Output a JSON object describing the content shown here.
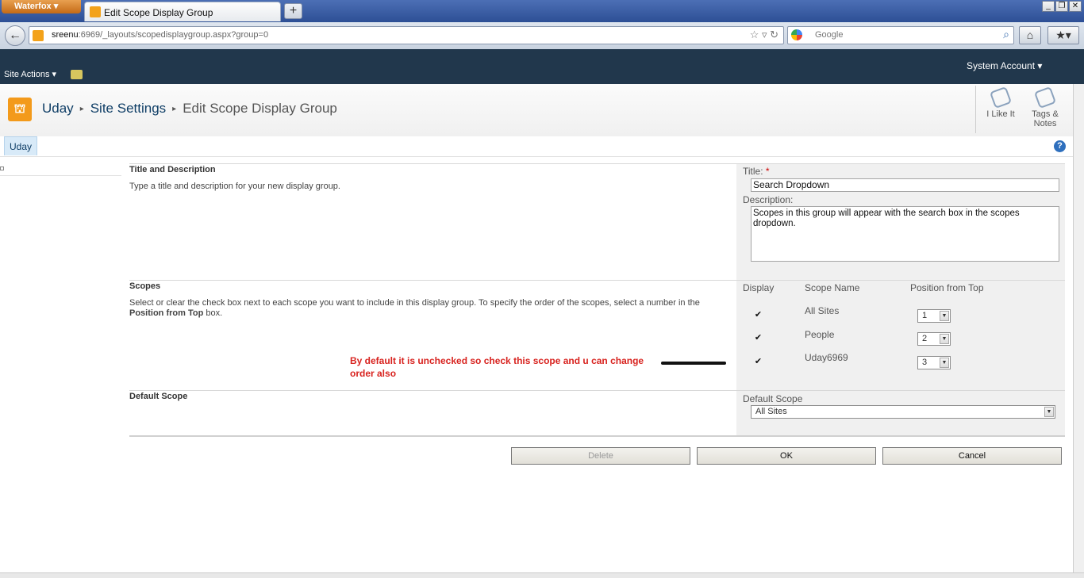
{
  "browser": {
    "app_menu": "Waterfox",
    "tab_title": "Edit Scope Display Group",
    "new_tab": "+",
    "url_host": "sreenu",
    "url_rest": ":6969/_layouts/scopedisplaygroup.aspx?group=0",
    "search_placeholder": "Google"
  },
  "sharepoint": {
    "site_actions": "Site Actions ▾",
    "account": "System Account ▾",
    "breadcrumb": [
      "Uday",
      "Site Settings",
      "Edit Scope Display Group"
    ],
    "ribbon": {
      "like": "I Like It",
      "tags": "Tags &",
      "notes": "Notes"
    },
    "top_nav_tab": "Uday",
    "help": "?"
  },
  "form": {
    "title_section": {
      "heading": "Title and Description",
      "description": "Type a title and description for your new display group.",
      "title_label": "Title:",
      "required_mark": "*",
      "title_value": "Search Dropdown",
      "description_label": "Description:",
      "description_value": "Scopes in this group will appear with the search box in the scopes dropdown."
    },
    "scopes_section": {
      "heading": "Scopes",
      "description_pre": "Select or clear the check box next to each scope you want to include in this display group. To specify the order of the scopes, select a number in the ",
      "description_bold": "Position from Top",
      "description_post": " box.",
      "col_display": "Display",
      "col_name": "Scope Name",
      "col_position": "Position from Top",
      "rows": [
        {
          "checked": true,
          "name": "All Sites",
          "position": "1"
        },
        {
          "checked": true,
          "name": "People",
          "position": "2"
        },
        {
          "checked": true,
          "name": "Uday6969",
          "position": "3"
        }
      ],
      "annotation_line1": "By default it is unchecked so check this scope and u can change",
      "annotation_line2": "order also"
    },
    "default_section": {
      "heading": "Default Scope",
      "label": "Default Scope",
      "value": "All Sites"
    },
    "buttons": {
      "delete": "Delete",
      "ok": "OK",
      "cancel": "Cancel"
    }
  }
}
